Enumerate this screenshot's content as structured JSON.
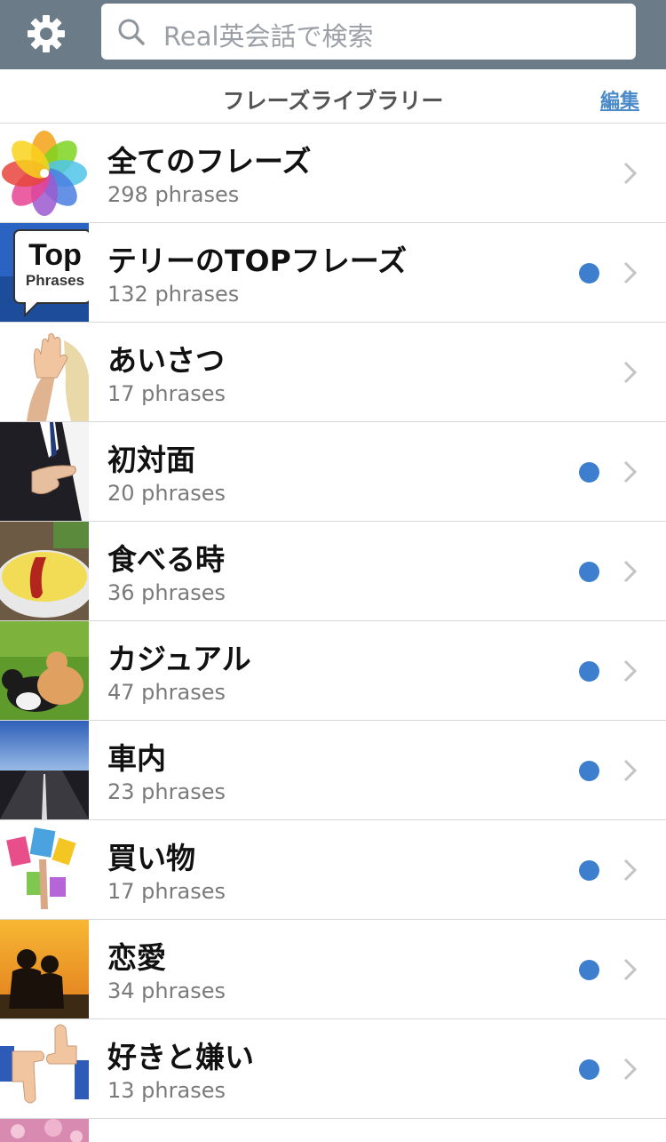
{
  "search": {
    "placeholder": "Real英会話で検索"
  },
  "header": {
    "title": "フレーズライブラリー",
    "edit_label": "編集"
  },
  "colors": {
    "topbar": "#6b7b88",
    "accent": "#3d7ecf",
    "link": "#4a8ac9"
  },
  "items": [
    {
      "label": "全てのフレーズ",
      "count": "298 phrases",
      "unread": false,
      "thumb": "photos-icon"
    },
    {
      "label": "テリーのTOPフレーズ",
      "count": "132 phrases",
      "unread": true,
      "thumb": "top-phrases-badge",
      "thumb_title": "Top",
      "thumb_sub": "Phrases"
    },
    {
      "label": "あいさつ",
      "count": "17 phrases",
      "unread": false,
      "thumb": "waving-hand"
    },
    {
      "label": "初対面",
      "count": "20 phrases",
      "unread": true,
      "thumb": "handshake"
    },
    {
      "label": "食べる時",
      "count": "36 phrases",
      "unread": true,
      "thumb": "omelette"
    },
    {
      "label": "カジュアル",
      "count": "47 phrases",
      "unread": true,
      "thumb": "cats-on-grass"
    },
    {
      "label": "車内",
      "count": "23 phrases",
      "unread": true,
      "thumb": "road"
    },
    {
      "label": "買い物",
      "count": "17 phrases",
      "unread": true,
      "thumb": "shopping-bags"
    },
    {
      "label": "恋愛",
      "count": "34 phrases",
      "unread": true,
      "thumb": "couple-sunset"
    },
    {
      "label": "好きと嫌い",
      "count": "13 phrases",
      "unread": true,
      "thumb": "thumbs-up-down"
    }
  ]
}
